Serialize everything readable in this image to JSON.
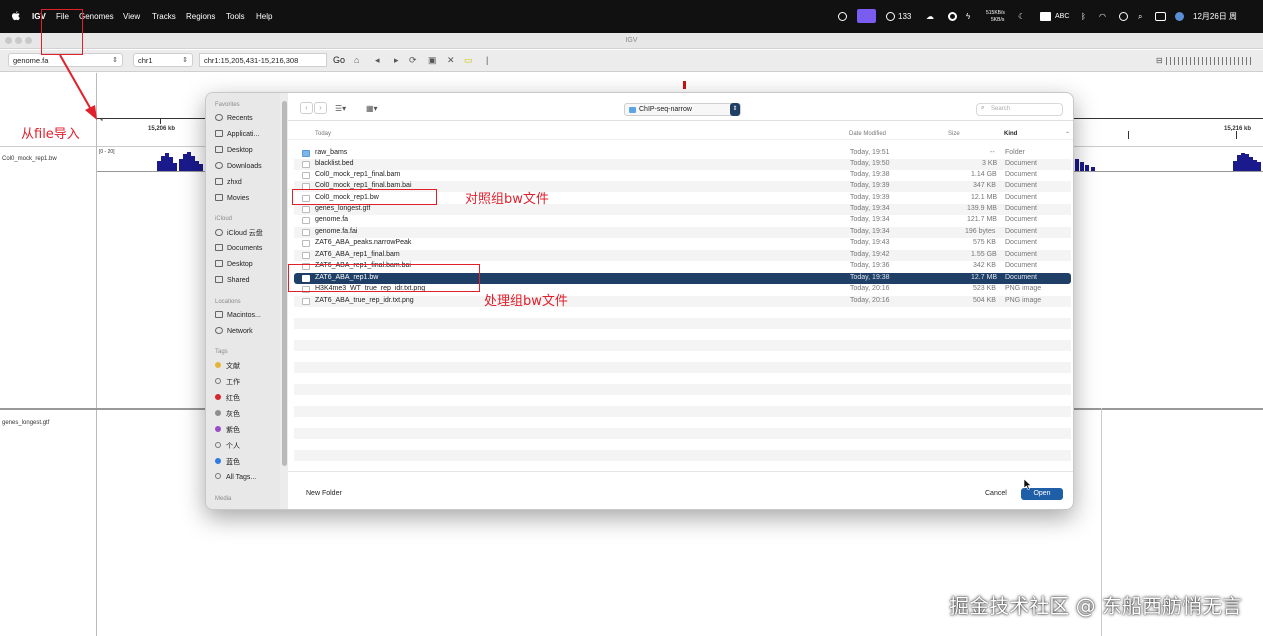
{
  "menubar": {
    "app": "IGV",
    "items": [
      "File",
      "Genomes",
      "View",
      "Tracks",
      "Regions",
      "Tools",
      "Help"
    ],
    "status": {
      "notif_count": "133",
      "net_up": "515KB/s",
      "net_down": "5KB/s",
      "input": "ABC",
      "datetime": "12月26日 周"
    }
  },
  "window": {
    "title": "IGV"
  },
  "toolbar": {
    "genome": "genome.fa",
    "chromosome": "chr1",
    "locus": "chr1:15,205,431-15,216,308",
    "go_label": "Go"
  },
  "ruler": {
    "tick_left": "15,206 kb",
    "tick_right": "15,216 kb",
    "range_label": "[0 - 20]"
  },
  "tracks": {
    "track1": "Col0_mock_rep1.bw",
    "track2": "genes_longest.gtf"
  },
  "dialog": {
    "location": "ChIP-seq-narrow",
    "search_placeholder": "Search",
    "sidebar": {
      "favorites_header": "Favorites",
      "favorites": [
        "Recents",
        "Applicati...",
        "Desktop",
        "Downloads",
        "zhxd",
        "Movies"
      ],
      "icloud_header": "iCloud",
      "icloud": [
        "iCloud 云盘",
        "Documents",
        "Desktop",
        "Shared"
      ],
      "locations_header": "Locations",
      "locations": [
        "Macintos...",
        "Network"
      ],
      "tags_header": "Tags",
      "tags": [
        {
          "label": "文献",
          "color": "#e5b53a"
        },
        {
          "label": "工作",
          "color": "#ffffff"
        },
        {
          "label": "红色",
          "color": "#d8262d"
        },
        {
          "label": "灰色",
          "color": "#8e8e8e"
        },
        {
          "label": "紫色",
          "color": "#9a4bc6"
        },
        {
          "label": "个人",
          "color": "#ffffff"
        },
        {
          "label": "蓝色",
          "color": "#2f7be0"
        },
        {
          "label": "All Tags..."
        }
      ],
      "media_header": "Media"
    },
    "columns": {
      "name": "Today",
      "date": "Date Modified",
      "size": "Size",
      "kind": "Kind"
    },
    "files": [
      {
        "name": "raw_bams",
        "date": "Today, 19:51",
        "size": "--",
        "kind": "Folder"
      },
      {
        "name": "blacklist.bed",
        "date": "Today, 19:50",
        "size": "3 KB",
        "kind": "Document"
      },
      {
        "name": "Col0_mock_rep1_final.bam",
        "date": "Today, 19:38",
        "size": "1.14 GB",
        "kind": "Document"
      },
      {
        "name": "Col0_mock_rep1_final.bam.bai",
        "date": "Today, 19:39",
        "size": "347 KB",
        "kind": "Document"
      },
      {
        "name": "Col0_mock_rep1.bw",
        "date": "Today, 19:39",
        "size": "12.1 MB",
        "kind": "Document"
      },
      {
        "name": "genes_longest.gtf",
        "date": "Today, 19:34",
        "size": "139.9 MB",
        "kind": "Document"
      },
      {
        "name": "genome.fa",
        "date": "Today, 19:34",
        "size": "121.7 MB",
        "kind": "Document"
      },
      {
        "name": "genome.fa.fai",
        "date": "Today, 19:34",
        "size": "196 bytes",
        "kind": "Document"
      },
      {
        "name": "ZAT6_ABA_peaks.narrowPeak",
        "date": "Today, 19:43",
        "size": "575 KB",
        "kind": "Document"
      },
      {
        "name": "ZAT6_ABA_rep1_final.bam",
        "date": "Today, 19:42",
        "size": "1.55 GB",
        "kind": "Document"
      },
      {
        "name": "ZAT6_ABA_rep1_final.bam.bai",
        "date": "Today, 19:36",
        "size": "342 KB",
        "kind": "Document"
      },
      {
        "name": "ZAT6_ABA_rep1.bw",
        "date": "Today, 19:38",
        "size": "12.7 MB",
        "kind": "Document"
      },
      {
        "name": "H3K4me3_WT_true_rep_idr.txt.png",
        "date": "Today, 20:16",
        "size": "523 KB",
        "kind": "PNG image"
      },
      {
        "name": "ZAT6_ABA_true_rep_idr.txt.png",
        "date": "Today, 20:16",
        "size": "504 KB",
        "kind": "PNG image"
      }
    ],
    "new_folder_label": "New Folder",
    "cancel_label": "Cancel",
    "open_label": "Open"
  },
  "annotations": {
    "import_label": "从file导入",
    "control_label": "对照组bw文件",
    "treatment_label": "处理组bw文件",
    "color": "#e0202b"
  },
  "watermark": "掘金技术社区 @ 东船西舫悄无言"
}
